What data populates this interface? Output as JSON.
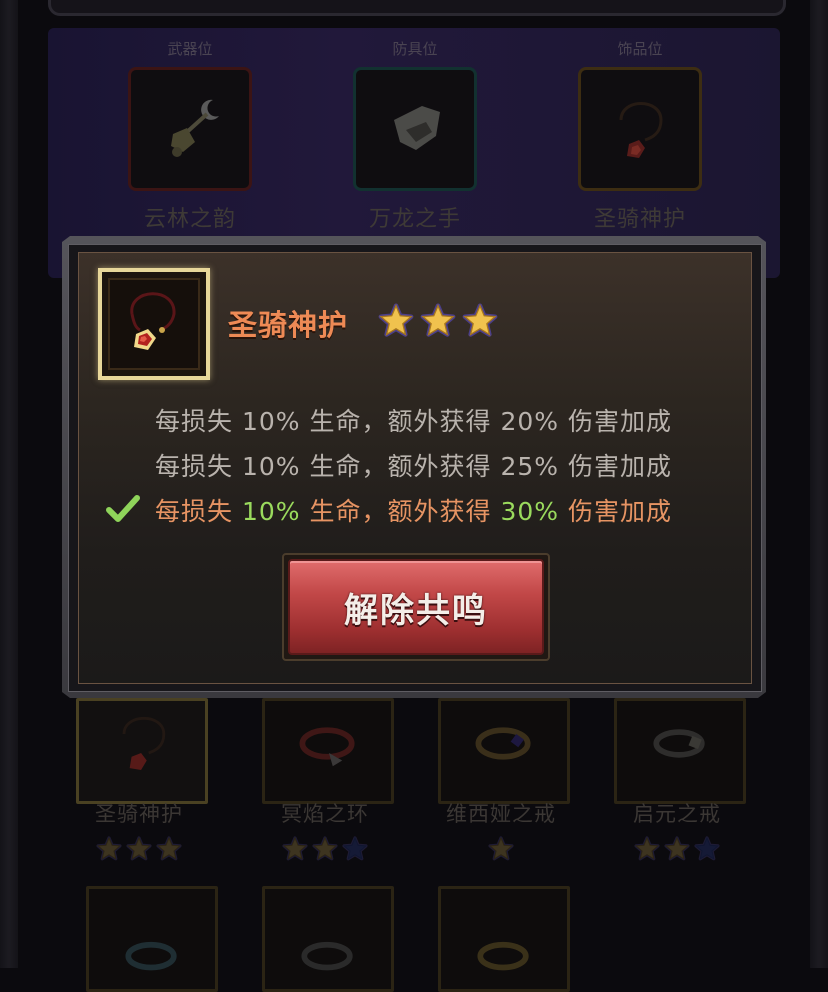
{
  "equip_slots": [
    {
      "title": "武器位",
      "name": "云林之韵"
    },
    {
      "title": "防具位",
      "name": "万龙之手"
    },
    {
      "title": "饰品位",
      "name": "圣骑神护"
    }
  ],
  "inventory": [
    {
      "name": "圣骑神护",
      "stars_filled": 3,
      "stars_total": 3
    },
    {
      "name": "冥焰之环",
      "stars_filled": 2,
      "stars_total": 3
    },
    {
      "name": "维西娅之戒",
      "stars_filled": 1,
      "stars_total": 1
    },
    {
      "name": "启元之戒",
      "stars_filled": 2,
      "stars_total": 3
    }
  ],
  "dialog": {
    "item_name": "圣骑神护",
    "stars": 3,
    "effects": [
      {
        "p1": "每损失",
        "v1": "10%",
        "p2": "生命，额外获得",
        "v2": "20%",
        "p3": "伤害加成",
        "active": false
      },
      {
        "p1": "每损失",
        "v1": "10%",
        "p2": "生命，额外获得",
        "v2": "25%",
        "p3": "伤害加成",
        "active": false
      },
      {
        "p1": "每损失",
        "v1": "10%",
        "p2": "生命，额外获得",
        "v2": "30%",
        "p3": "伤害加成",
        "active": true
      }
    ],
    "button_label": "解除共鸣"
  },
  "colors": {
    "item_name": "#ee8a55",
    "active_effect": "#e79463",
    "highlight_value": "#9ada5d",
    "button": "#c24848"
  }
}
